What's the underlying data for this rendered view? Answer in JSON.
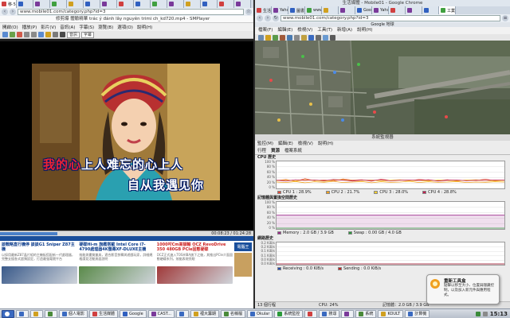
{
  "colors": {
    "cpu1": "#e04a3a",
    "cpu2": "#f0a020",
    "cpu3": "#f6d030",
    "cpu4": "#c02050",
    "memory": "#9a2a8a",
    "swap": "#2a9a3a",
    "receiving": "#2a4aaa",
    "sending": "#c02020",
    "accent": "#4a80c8"
  },
  "left": {
    "tabs": [
      {
        "label": "移·5",
        "icon": "#d04040"
      },
      {
        "label": "",
        "icon": "#3060c0"
      },
      {
        "label": "",
        "icon": "#7a3a9a"
      },
      {
        "label": "",
        "icon": "#40a040"
      },
      {
        "label": "",
        "icon": "#d0a020"
      },
      {
        "label": "",
        "icon": "#3060c0"
      },
      {
        "label": "",
        "icon": "#7a3a9a"
      },
      {
        "label": "",
        "icon": "#d04040"
      },
      {
        "label": "",
        "icon": "#3060c0"
      },
      {
        "label": "",
        "icon": "#40a040"
      },
      {
        "label": "",
        "icon": "#7a3a9a"
      },
      {
        "label": "",
        "icon": "#d0a020"
      },
      {
        "label": "",
        "icon": "#3060c0"
      },
      {
        "label": "",
        "icon": "#d04040"
      },
      {
        "label": "",
        "icon": "#7a3a9a"
      }
    ],
    "url": "www.mobile01.com/category.php?id=3",
    "smplayer_title": "修剪爆   體驗精華  trác ý đánh lây nguyên  trimi ch_kd720.mp4 - SMPlayer",
    "menu": [
      "開啟(O)",
      "播放(P)",
      "影片(V)",
      "音訊(A)",
      "字幕(S)",
      "瀏覽(B)",
      "選項(O)",
      "說明(H)"
    ],
    "toolbar_selects": [
      "音訊",
      "字幕"
    ],
    "lyric_highlight": "我的心",
    "lyric_line1_rest": "上人难忘的心上人",
    "lyric_line2": "自从我遇见你",
    "progress": 0.3,
    "time": "00:08:23 / 01:24:28",
    "ads": [
      {
        "title": "談戰略直行機停 談談G1 Sniper Z87主機",
        "body": "以採用最新Z87晶片組的主機板搭配新一代處理器，完整支援各式超頻設定，打造最強電競平台",
        "img": "#3a5a8a",
        "red": false
      },
      {
        "title": "硬碟Hi-m 旗艦搭載 Intel Core i7-4790處理器4K螢幕XF-DLUXE主機",
        "body": "效能與畫質兼具，適合影音剪輯與遊戲玩家，詳細規格請見活動頁面說明",
        "img": "#5a8a4a",
        "red": false
      },
      {
        "title": "1000吋Cm高額輸 OCZ RevoDrive 350 480GB PCIe固態硬碟",
        "body": "OCZ正式進入TOSHIBA旗下之後，其推出PCIe介面固態硬碟系列，效能表現亮眼",
        "img": "#a03a3a",
        "red": true
      }
    ],
    "side_icon_label": "電腦王"
  },
  "right": {
    "window_title": "生活媒體 - Mobile01 - Google Chrome",
    "tabs": [
      {
        "label": "生活",
        "icon": "#d04040"
      },
      {
        "label": "Yaho",
        "icon": "#7a3a9a"
      },
      {
        "label": "圖書",
        "icon": "#3060c0"
      },
      {
        "label": "www.b",
        "icon": "#40a040"
      },
      {
        "label": "",
        "icon": "#d0a020"
      },
      {
        "label": "",
        "icon": "#7a3a9a"
      },
      {
        "label": "Googl",
        "icon": "#3060c0"
      },
      {
        "label": "Yaho",
        "icon": "#7a3a9a"
      },
      {
        "label": "",
        "icon": "#d04040"
      },
      {
        "label": "",
        "icon": "#7a3a9a"
      },
      {
        "label": "",
        "icon": "#3060c0"
      },
      {
        "label": "工業:",
        "icon": "#40a040"
      }
    ],
    "url": "www.mobile01.com/category.php?id=3",
    "earth_title": "Google 地球",
    "earth_menu": [
      "檔案(F)",
      "編輯(E)",
      "檢視(V)",
      "工具(T)",
      "新增(A)",
      "說明(H)"
    ],
    "sysmon": {
      "title": "系統監視器",
      "menu": [
        "監控(M)",
        "編輯(E)",
        "檢視(V)",
        "說明(H)"
      ],
      "tabs": [
        "行程",
        "資源",
        "檔案系統"
      ],
      "cpu_title": "CPU 歷史",
      "cpu_ticks": [
        "100 %",
        "80 %",
        "60 %",
        "40 %",
        "20 %",
        "0 %"
      ],
      "cpu_legend": [
        "CPU 1 : 28.9%",
        "CPU 2 : 21.7%",
        "CPU 3 : 28.0%",
        "CPU 4 : 28.8%"
      ],
      "mem_title": "記憶體與置換空間歷史",
      "mem_ticks": [
        "100 %",
        "80 %",
        "60 %",
        "40 %",
        "20 %",
        "0 %"
      ],
      "mem_legend": [
        "Memory : 2.0 GB / 3.9 GB",
        "Swap : 0.00 GB / 4.0 GB"
      ],
      "net_title": "網路歷史",
      "net_ticks": [
        "0.2 KiB/s",
        "0.2 KiB/s",
        "0.1 KiB/s",
        "0.1 KiB/s",
        "0.0 KiB/s",
        "0.0 KiB/s"
      ],
      "net_legend": [
        "Receiving : 0.0 KiB/s",
        "Sending : 0.0 KiB/s"
      ],
      "status": [
        "13 個行程",
        "CPU: 24%",
        "記憶體：2.0 GB / 3.9 GB"
      ]
    }
  },
  "chart_data": [
    {
      "type": "line",
      "title": "CPU 歷史",
      "ylim": [
        0,
        100
      ],
      "series": [
        {
          "name": "CPU 1",
          "values": [
            28,
            32,
            25,
            35,
            27,
            30,
            26,
            34,
            29,
            31,
            25,
            33,
            28,
            30,
            27,
            32,
            29,
            28,
            31,
            26,
            30,
            28,
            33,
            27,
            29
          ]
        },
        {
          "name": "CPU 2",
          "values": [
            22,
            20,
            24,
            19,
            23,
            21,
            25,
            20,
            22,
            24,
            19,
            23,
            21,
            22,
            25,
            20,
            23,
            21,
            22,
            24,
            20,
            22,
            21,
            23,
            22
          ]
        },
        {
          "name": "CPU 3",
          "values": [
            27,
            30,
            26,
            31,
            28,
            25,
            29,
            32,
            27,
            28,
            30,
            26,
            29,
            31,
            27,
            28,
            26,
            30,
            28,
            27,
            29,
            31,
            28,
            26,
            28
          ]
        },
        {
          "name": "CPU 4",
          "values": [
            29,
            26,
            31,
            28,
            30,
            27,
            32,
            29,
            26,
            30,
            28,
            31,
            27,
            29,
            30,
            28,
            31,
            26,
            29,
            30,
            27,
            29,
            28,
            30,
            29
          ]
        }
      ]
    },
    {
      "type": "area",
      "title": "記憶體與置換空間歷史",
      "ylim": [
        0,
        100
      ],
      "series": [
        {
          "name": "Memory",
          "values": [
            51,
            51,
            51,
            51,
            51,
            51,
            51,
            51,
            51,
            51,
            51,
            51,
            51
          ]
        },
        {
          "name": "Swap",
          "values": [
            0,
            0,
            0,
            0,
            0,
            0,
            0,
            0,
            0,
            0,
            0,
            0,
            0
          ]
        }
      ]
    },
    {
      "type": "line",
      "title": "網路歷史",
      "series": [
        {
          "name": "Receiving",
          "values": [
            0,
            0,
            0,
            0,
            0,
            0,
            0,
            0,
            0,
            0,
            0,
            0,
            0
          ]
        },
        {
          "name": "Sending",
          "values": [
            0,
            0,
            0,
            0,
            0,
            0,
            0,
            0,
            0,
            0,
            0,
            0,
            0
          ]
        }
      ]
    }
  ],
  "notification": {
    "title": "重新工具盒",
    "body": "點擊以移至大小、位置與隱藏控制，以及加入新元件與應用程式。"
  },
  "taskbar": {
    "items": [
      {
        "label": "",
        "icon": "#3a6ac0"
      },
      {
        "label": "",
        "icon": "#d0a020"
      },
      {
        "label": "",
        "icon": "#4a8a3a"
      },
      {
        "label": "個人電影",
        "icon": "#3a6ac0"
      },
      {
        "label": "生活媒體",
        "icon": "#d04040"
      },
      {
        "label": "Google",
        "icon": "#3060c0"
      },
      {
        "label": "CAST...",
        "icon": "#7a3a9a"
      },
      {
        "label": "",
        "icon": "#3a6ac0"
      },
      {
        "label": "裡大籌期",
        "icon": "#d0a020"
      },
      {
        "label": "名稱檔",
        "icon": "#4a8a3a"
      },
      {
        "label": "Okular",
        "icon": "#3a6ac0"
      },
      {
        "label": "系統監控",
        "icon": "#2a9a3a"
      },
      {
        "label": "",
        "icon": "#d04040"
      },
      {
        "label": "搜尋",
        "icon": "#3a6ac0"
      },
      {
        "label": "",
        "icon": "#7a3a9a"
      },
      {
        "label": "系統",
        "icon": "#4a8a3a"
      },
      {
        "label": "KOULT",
        "icon": "#d0a020"
      },
      {
        "label": "計算機",
        "icon": "#3a6ac0"
      }
    ],
    "clock": "15:13"
  }
}
